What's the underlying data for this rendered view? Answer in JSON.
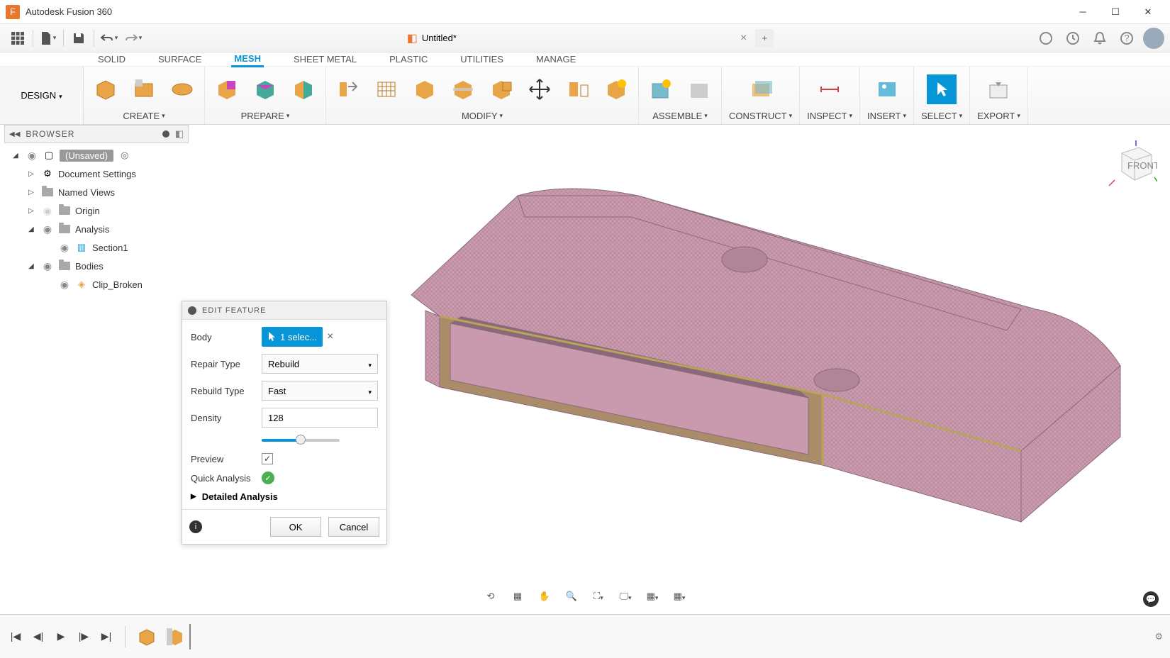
{
  "app": {
    "title": "Autodesk Fusion 360"
  },
  "file": {
    "tab_name": "Untitled*"
  },
  "workspace": {
    "label": "DESIGN"
  },
  "ws_tabs": [
    "SOLID",
    "SURFACE",
    "MESH",
    "SHEET METAL",
    "PLASTIC",
    "UTILITIES",
    "MANAGE"
  ],
  "ws_active": "MESH",
  "ribbon_groups": {
    "create": "CREATE",
    "prepare": "PREPARE",
    "modify": "MODIFY",
    "assemble": "ASSEMBLE",
    "construct": "CONSTRUCT",
    "inspect": "INSPECT",
    "insert": "INSERT",
    "select": "SELECT",
    "export": "EXPORT"
  },
  "browser": {
    "title": "BROWSER",
    "root": "(Unsaved)",
    "doc_settings": "Document Settings",
    "named_views": "Named Views",
    "origin": "Origin",
    "analysis": "Analysis",
    "section1": "Section1",
    "bodies": "Bodies",
    "clip": "Clip_Broken"
  },
  "dialog": {
    "title": "EDIT FEATURE",
    "body_label": "Body",
    "body_value": "1 selec...",
    "repair_label": "Repair Type",
    "repair_value": "Rebuild",
    "rebuild_label": "Rebuild Type",
    "rebuild_value": "Fast",
    "density_label": "Density",
    "density_value": "128",
    "preview_label": "Preview",
    "quick_label": "Quick Analysis",
    "detailed_label": "Detailed Analysis",
    "ok": "OK",
    "cancel": "Cancel"
  }
}
